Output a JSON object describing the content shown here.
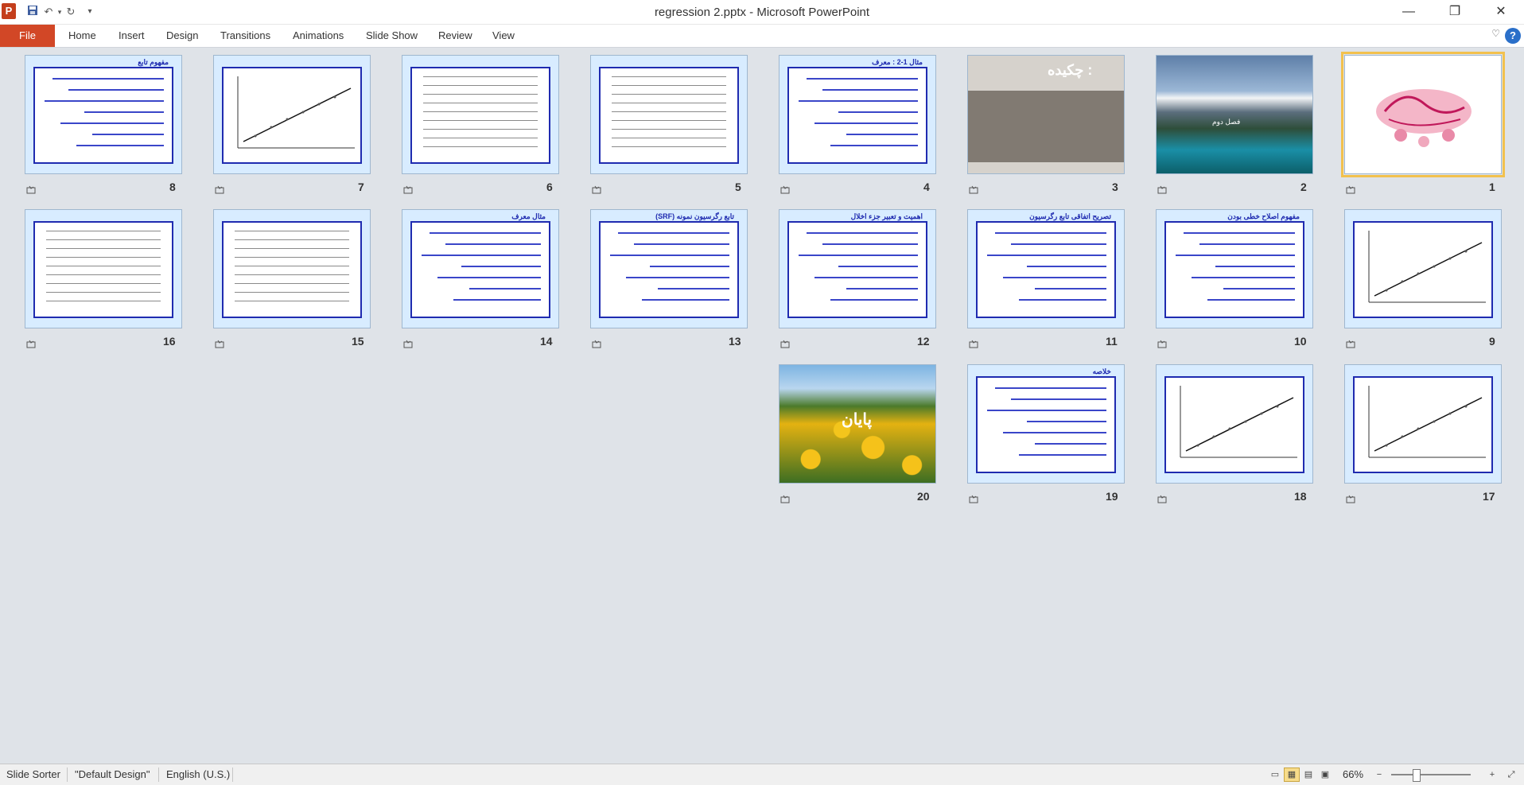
{
  "window": {
    "title": "regression 2.pptx  -  Microsoft PowerPoint",
    "app_icon": "P",
    "controls": {
      "minimize": "—",
      "restore": "❐",
      "close": "✕"
    }
  },
  "quick_access": {
    "save": "save-icon",
    "undo": "undo-icon",
    "redo": "redo-icon",
    "customize": "customize-icon"
  },
  "ribbon": {
    "file_tab": "File",
    "tabs": [
      "Home",
      "Insert",
      "Design",
      "Transitions",
      "Animations",
      "Slide Show",
      "Review",
      "View"
    ],
    "help": "?"
  },
  "slides": [
    {
      "number": "1",
      "kind": "calligraphy",
      "selected": true
    },
    {
      "number": "2",
      "kind": "photo-mountain",
      "caption": "فصل دوم"
    },
    {
      "number": "3",
      "kind": "cover",
      "title": "چکیده :"
    },
    {
      "number": "4",
      "kind": "text",
      "title": "مثال 1-2 : معرف"
    },
    {
      "number": "5",
      "kind": "table"
    },
    {
      "number": "6",
      "kind": "table"
    },
    {
      "number": "7",
      "kind": "chart"
    },
    {
      "number": "8",
      "kind": "text",
      "title": "مفهوم تابع"
    },
    {
      "number": "9",
      "kind": "chart"
    },
    {
      "number": "10",
      "kind": "text",
      "title": "مفهوم اصلاح خطی بودن"
    },
    {
      "number": "11",
      "kind": "text",
      "title": "تصریح اتفاقی تابع رگرسیون"
    },
    {
      "number": "12",
      "kind": "text",
      "title": "اهمیت و تعبیر جزء اخلال"
    },
    {
      "number": "13",
      "kind": "text",
      "title": "تابع رگرسیون نمونه (SRF)"
    },
    {
      "number": "14",
      "kind": "text",
      "title": "مثال معرف"
    },
    {
      "number": "15",
      "kind": "table"
    },
    {
      "number": "16",
      "kind": "table"
    },
    {
      "number": "17",
      "kind": "chart"
    },
    {
      "number": "18",
      "kind": "chart"
    },
    {
      "number": "19",
      "kind": "text",
      "title": "خلاصه"
    },
    {
      "number": "20",
      "kind": "photo-sunflower",
      "caption": "پایان"
    }
  ],
  "status": {
    "view": "Slide Sorter",
    "theme": "\"Default Design\"",
    "language": "English (U.S.)",
    "zoom": "66%",
    "zoom_level": 0.66
  }
}
